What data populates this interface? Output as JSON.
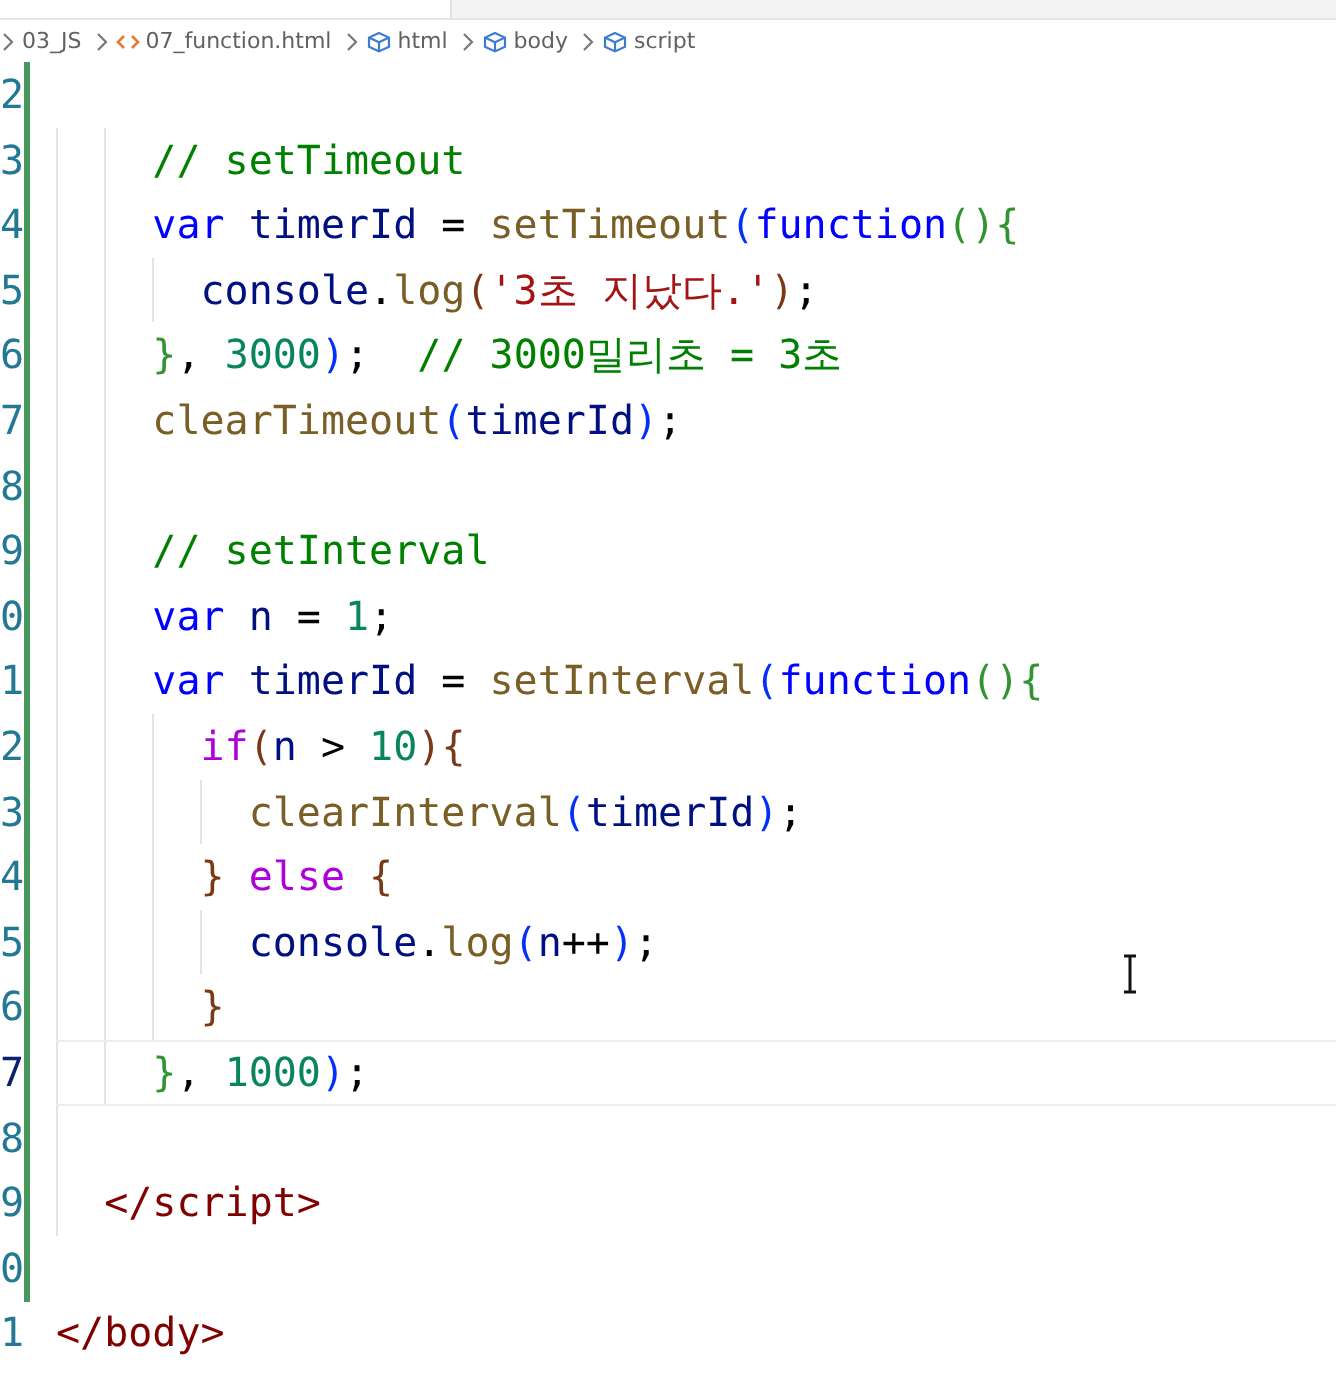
{
  "breadcrumb": [
    {
      "label": "03_JS",
      "kind": "folder"
    },
    {
      "label": "07_function.html",
      "kind": "file"
    },
    {
      "label": "html",
      "kind": "symbol"
    },
    {
      "label": "body",
      "kind": "symbol"
    },
    {
      "label": "script",
      "kind": "symbol"
    }
  ],
  "editor": {
    "lines": [
      {
        "number": "2",
        "current": false
      },
      {
        "number": "3",
        "current": false,
        "tokens": [
          {
            "text": "    // setTimeout",
            "kind": "comment"
          }
        ]
      },
      {
        "number": "4",
        "current": false,
        "tokens": [
          {
            "text": "    var",
            "kind": "keyword"
          },
          {
            "text": " timerId",
            "kind": "variable"
          },
          {
            "text": " = ",
            "kind": "plain"
          },
          {
            "text": "setTimeout",
            "kind": "function"
          },
          {
            "text": "(",
            "kind": "bracket1"
          },
          {
            "text": "function",
            "kind": "keyword"
          },
          {
            "text": "()",
            "kind": "bracket2"
          },
          {
            "text": "{",
            "kind": "bracket2"
          }
        ]
      },
      {
        "number": "5",
        "current": false,
        "tokens": [
          {
            "text": "      console",
            "kind": "variable"
          },
          {
            "text": ".",
            "kind": "plain"
          },
          {
            "text": "log",
            "kind": "function"
          },
          {
            "text": "(",
            "kind": "bracket3"
          },
          {
            "text": "'3초 지났다.'",
            "kind": "string"
          },
          {
            "text": ")",
            "kind": "bracket3"
          },
          {
            "text": ";",
            "kind": "plain"
          }
        ]
      },
      {
        "number": "6",
        "current": false,
        "tokens": [
          {
            "text": "    }",
            "kind": "bracket2"
          },
          {
            "text": ", ",
            "kind": "plain"
          },
          {
            "text": "3000",
            "kind": "number"
          },
          {
            "text": ")",
            "kind": "bracket1"
          },
          {
            "text": ";  ",
            "kind": "plain"
          },
          {
            "text": "// 3000밀리초 = 3초",
            "kind": "comment"
          }
        ]
      },
      {
        "number": "7",
        "current": false,
        "tokens": [
          {
            "text": "    clearTimeout",
            "kind": "function"
          },
          {
            "text": "(",
            "kind": "bracket1"
          },
          {
            "text": "timerId",
            "kind": "variable"
          },
          {
            "text": ")",
            "kind": "bracket1"
          },
          {
            "text": ";",
            "kind": "plain"
          }
        ]
      },
      {
        "number": "8",
        "current": false
      },
      {
        "number": "9",
        "current": false,
        "tokens": [
          {
            "text": "    // setInterval",
            "kind": "comment"
          }
        ]
      },
      {
        "number": "0",
        "current": false,
        "tokens": [
          {
            "text": "    var",
            "kind": "keyword"
          },
          {
            "text": " n",
            "kind": "variable"
          },
          {
            "text": " = ",
            "kind": "plain"
          },
          {
            "text": "1",
            "kind": "number"
          },
          {
            "text": ";",
            "kind": "plain"
          }
        ]
      },
      {
        "number": "1",
        "current": false,
        "tokens": [
          {
            "text": "    var",
            "kind": "keyword"
          },
          {
            "text": " timerId",
            "kind": "variable"
          },
          {
            "text": " = ",
            "kind": "plain"
          },
          {
            "text": "setInterval",
            "kind": "function"
          },
          {
            "text": "(",
            "kind": "bracket1"
          },
          {
            "text": "function",
            "kind": "keyword"
          },
          {
            "text": "()",
            "kind": "bracket2"
          },
          {
            "text": "{",
            "kind": "bracket2"
          }
        ]
      },
      {
        "number": "2",
        "current": false,
        "tokens": [
          {
            "text": "      if",
            "kind": "control"
          },
          {
            "text": "(",
            "kind": "bracket3"
          },
          {
            "text": "n",
            "kind": "variable"
          },
          {
            "text": " > ",
            "kind": "plain"
          },
          {
            "text": "10",
            "kind": "number"
          },
          {
            "text": ")",
            "kind": "bracket3"
          },
          {
            "text": "{",
            "kind": "bracket3"
          }
        ]
      },
      {
        "number": "3",
        "current": false,
        "tokens": [
          {
            "text": "        clearInterval",
            "kind": "function"
          },
          {
            "text": "(",
            "kind": "bracket1"
          },
          {
            "text": "timerId",
            "kind": "variable"
          },
          {
            "text": ")",
            "kind": "bracket1"
          },
          {
            "text": ";",
            "kind": "plain"
          }
        ]
      },
      {
        "number": "4",
        "current": false,
        "tokens": [
          {
            "text": "      }",
            "kind": "bracket3"
          },
          {
            "text": " else ",
            "kind": "control"
          },
          {
            "text": "{",
            "kind": "bracket3"
          }
        ]
      },
      {
        "number": "5",
        "current": false,
        "tokens": [
          {
            "text": "        console",
            "kind": "variable"
          },
          {
            "text": ".",
            "kind": "plain"
          },
          {
            "text": "log",
            "kind": "function"
          },
          {
            "text": "(",
            "kind": "bracket1"
          },
          {
            "text": "n",
            "kind": "variable"
          },
          {
            "text": "++",
            "kind": "plain"
          },
          {
            "text": ")",
            "kind": "bracket1"
          },
          {
            "text": ";",
            "kind": "plain"
          }
        ]
      },
      {
        "number": "6",
        "current": false,
        "tokens": [
          {
            "text": "      }",
            "kind": "bracket3"
          }
        ]
      },
      {
        "number": "7",
        "current": true,
        "tokens": [
          {
            "text": "    }",
            "kind": "bracket2"
          },
          {
            "text": ", ",
            "kind": "plain"
          },
          {
            "text": "1000",
            "kind": "number"
          },
          {
            "text": ")",
            "kind": "bracket1"
          },
          {
            "text": ";",
            "kind": "plain"
          }
        ]
      },
      {
        "number": "8",
        "current": false
      },
      {
        "number": "9",
        "current": false,
        "tokens": [
          {
            "text": "  </script>",
            "kind": "tag"
          }
        ]
      },
      {
        "number": "0",
        "current": false
      },
      {
        "number": "1",
        "current": false,
        "tokens": [
          {
            "text": "</body>",
            "kind": "tag"
          }
        ]
      }
    ]
  }
}
